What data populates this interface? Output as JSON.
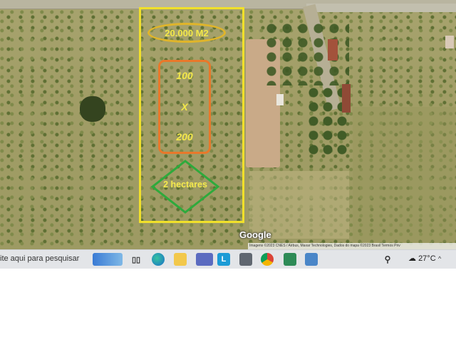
{
  "annotations": {
    "area_label": "20.000 M2",
    "width_label": "100",
    "times_label": "X",
    "length_label": "200",
    "hectares_label": "2 hectares"
  },
  "map": {
    "provider_label": "Google",
    "attribution": "Imagens ©2023 CNES / Airbus, Maxar Technologies, Dados do mapa ©2023   Brasil   Termos   Priv"
  },
  "taskbar": {
    "search_placeholder": "ite aqui para pesquisar",
    "weather_temp": "27°C",
    "icons": [
      "widgets-icon",
      "task-view-icon",
      "edge-icon",
      "file-explorer-icon",
      "teams-icon",
      "l-app-icon",
      "calculator-icon",
      "chrome-icon",
      "spreadsheet-icon",
      "document-icon"
    ]
  },
  "colors": {
    "plot_outline": "#f1e02a",
    "oval": "#e0b52a",
    "dimension_box": "#e9782a",
    "hectares_diamond": "#2eaa3c",
    "label_text": "#f3e84a"
  }
}
